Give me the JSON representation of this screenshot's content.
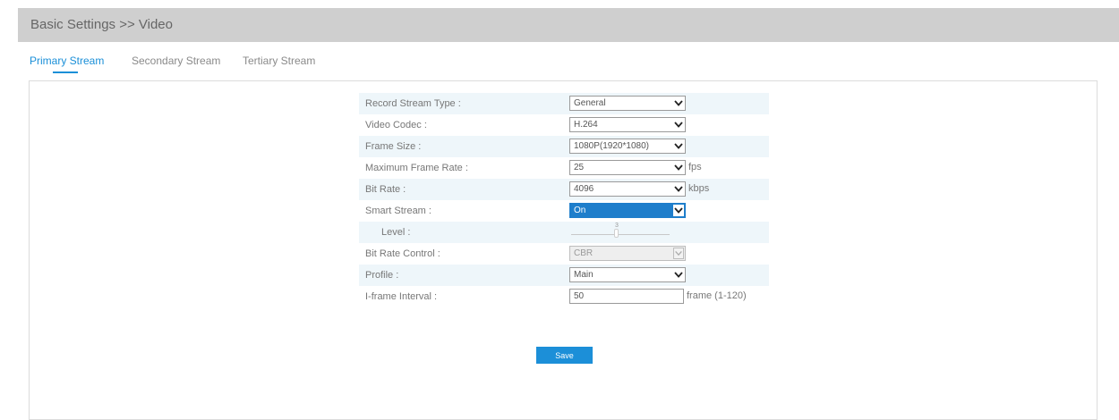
{
  "breadcrumb": "Basic Settings >> Video",
  "tabs": [
    {
      "label": "Primary Stream",
      "active": true
    },
    {
      "label": "Secondary Stream",
      "active": false
    },
    {
      "label": "Tertiary Stream",
      "active": false
    }
  ],
  "form": {
    "record_stream_type": {
      "label": "Record Stream Type :",
      "value": "General"
    },
    "video_codec": {
      "label": "Video Codec :",
      "value": "H.264"
    },
    "frame_size": {
      "label": "Frame Size :",
      "value": "1080P(1920*1080)"
    },
    "max_frame_rate": {
      "label": "Maximum Frame Rate :",
      "value": "25",
      "unit": "fps"
    },
    "bit_rate": {
      "label": "Bit Rate :",
      "value": "4096",
      "unit": "kbps"
    },
    "smart_stream": {
      "label": "Smart Stream :",
      "value": "On"
    },
    "level": {
      "label": "Level :",
      "slider_value": "3",
      "fraction": 0.45
    },
    "bit_rate_control": {
      "label": "Bit Rate Control :",
      "value": "CBR",
      "disabled": true
    },
    "profile": {
      "label": "Profile :",
      "value": "Main"
    },
    "iframe_interval": {
      "label": "I-frame Interval :",
      "value": "50",
      "unit": "frame (1-120)"
    }
  },
  "save_label": "Save",
  "colors": {
    "accent": "#1a8fd8",
    "title_bar": "#cfcfcf",
    "row_shade": "#eef6fa",
    "active_select": "#1f7ecb"
  },
  "icons": {
    "dropdown": "chevron-down-icon"
  }
}
